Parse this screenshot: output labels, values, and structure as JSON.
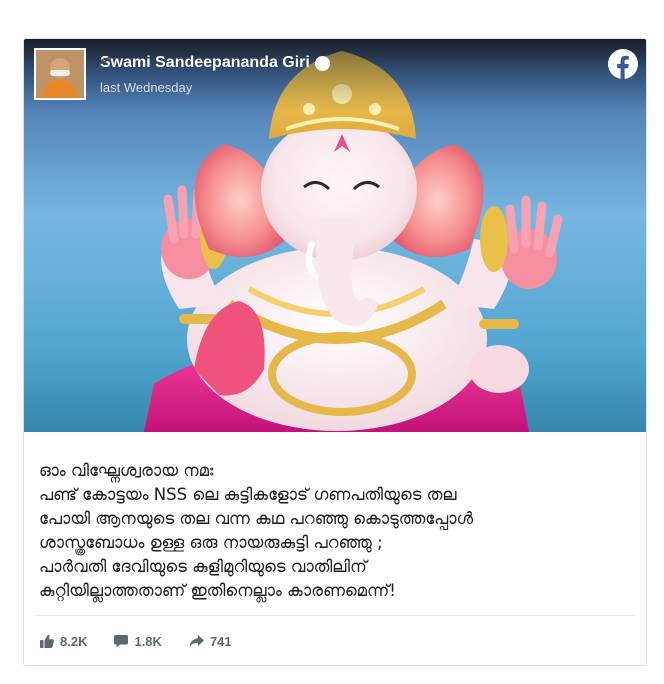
{
  "post": {
    "author": "Swami Sandeepananda Giri",
    "timestamp": "last Wednesday",
    "icons": {
      "avatar": "profile-photo",
      "verified": "verified-badge-icon",
      "platform": "facebook-logo-icon"
    },
    "image_description": "ganesha-idol-photo",
    "text_lines": [
      "ഓം വിഘ്നേശ്വരായ നമഃ",
      "പണ്ട് കോട്ടയം NSS ലെ കുട്ടികളോട് ഗണപതിയുടെ തല",
      "പോയി ആനയുടെ തല വന്ന കഥ പറഞ്ഞു കൊടുത്തപ്പോൾ",
      "ശാസ്ത്രബോധം ഉള്ള ഒരു നായരുകുട്ടി പറഞ്ഞു ;",
      "പാർവതി ദേവിയുടെ കുളിമുറിയുടെ വാതിലിന്",
      "കുറ്റിയില്ലാത്തതാണ് ഇതിനെല്ലാം കാരണമെന്ന്!"
    ],
    "stats": {
      "likes": "8.2K",
      "comments": "1.8K",
      "shares": "741"
    }
  },
  "colors": {
    "text": "#1c1e21",
    "muted": "#606770",
    "facebook": "#ffffff"
  }
}
